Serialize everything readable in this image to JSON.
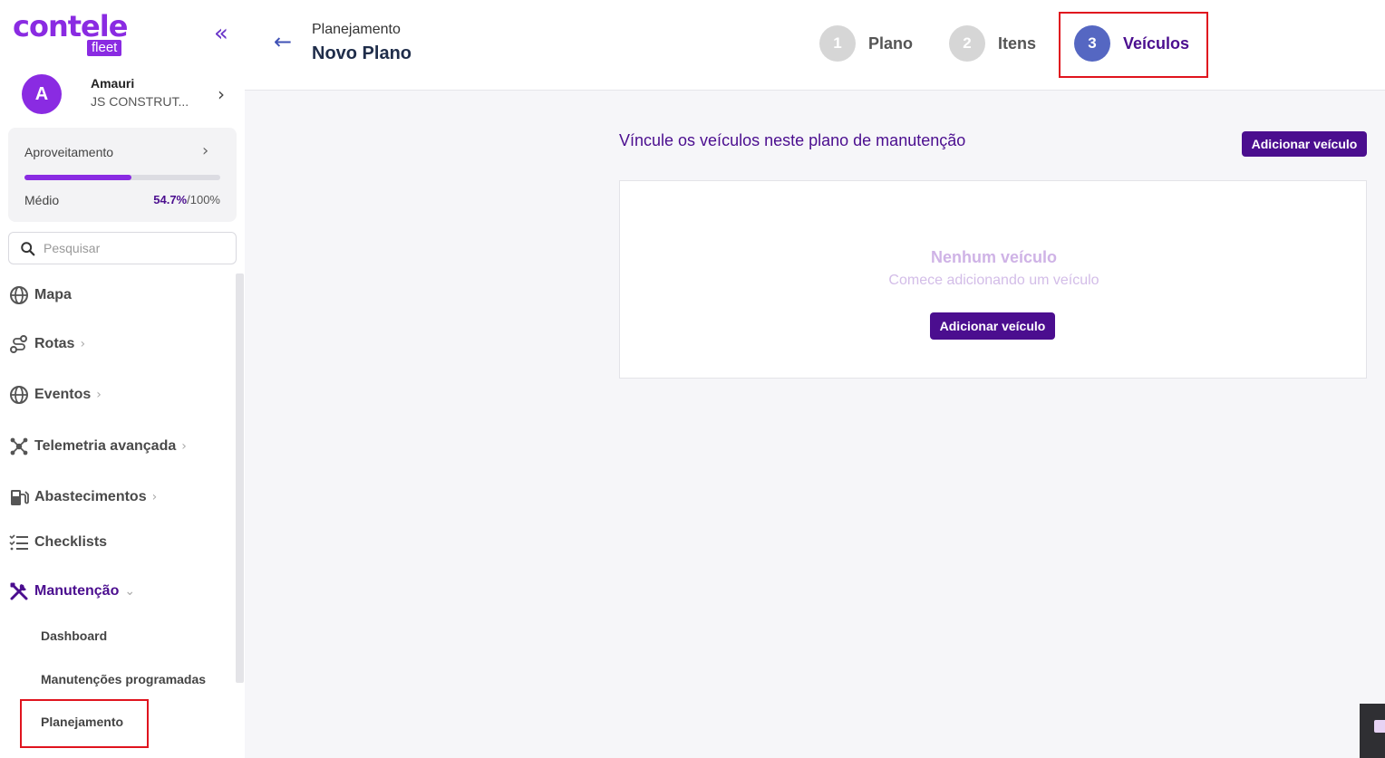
{
  "brand": {
    "logo_main": "contele",
    "logo_sub": "fleet"
  },
  "sidebar": {
    "collapse_icon": "«",
    "user": {
      "initial": "A",
      "name": "Amauri",
      "company": "JS CONSTRUT..."
    },
    "performance": {
      "title": "Aproveitamento",
      "level": "Médio",
      "value": "54.7%",
      "max": "/100%",
      "fraction": 0.547
    },
    "search": {
      "placeholder": "Pesquisar"
    },
    "items": [
      {
        "label": "Mapa",
        "icon": "globe-icon",
        "has_chevron": false
      },
      {
        "label": "Rotas",
        "icon": "route-icon",
        "has_chevron": true
      },
      {
        "label": "Eventos",
        "icon": "globe-icon",
        "has_chevron": true
      },
      {
        "label": "Telemetria avançada",
        "icon": "telemetry-icon",
        "has_chevron": true
      },
      {
        "label": "Abastecimentos",
        "icon": "fuel-pump-icon",
        "has_chevron": true
      },
      {
        "label": "Checklists",
        "icon": "checklist-icon",
        "has_chevron": false
      },
      {
        "label": "Manutenção",
        "icon": "tools-icon",
        "has_chevron": true,
        "expanded": true
      }
    ],
    "sub_items": [
      "Dashboard",
      "Manutenções programadas",
      "Planejamento"
    ]
  },
  "header": {
    "breadcrumb_parent": "Planejamento",
    "title": "Novo Plano",
    "steps": [
      {
        "number": "1",
        "label": "Plano"
      },
      {
        "number": "2",
        "label": "Itens"
      },
      {
        "number": "3",
        "label": "Veículos",
        "active": true
      }
    ]
  },
  "main": {
    "section_title": "Víncule os veículos neste plano de manutenção",
    "add_button_label": "Adicionar veículo",
    "empty": {
      "title": "Nenhum veículo",
      "subtitle": "Comece adicionando um veículo",
      "button_label": "Adicionar veículo"
    }
  },
  "colors": {
    "brand": "#8a2be2",
    "primary": "#4b0e8f",
    "step_active": "#5567c2",
    "highlight": "#e0141e"
  }
}
